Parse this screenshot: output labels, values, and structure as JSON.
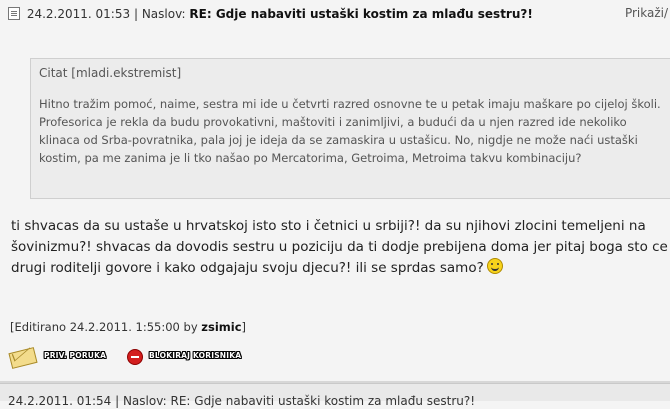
{
  "post": {
    "date": "24.2.2011. 01:53",
    "separator": "|",
    "subject_label": "Naslov:",
    "subject": "RE: Gdje nabaviti ustaški kostim za mlađu sestru?!",
    "show_label": "Prikaži/",
    "quote": {
      "author": "Citat [mladi.ekstremist]",
      "text": "Hitno tražim pomoć, naime, sestra mi ide u četvrti razred osnovne te u petak imaju maškare po cijeloj školi. Profesorica je rekla da budu provokativni, maštoviti i zanimljivi, a budući da u njen razred ide nekoliko klinaca od Srba-povratnika, pala joj je ideja da se zamaskira u ustašicu. No, nigdje ne može naći ustaški kostim, pa me zanima je li tko našao po Mercatorima, Getroima, Metroima takvu kombinaciju?"
    },
    "reply": "ti shvacas da su ustaše u hrvatskoj isto sto i četnici u srbiji?! da su njihovi zlocini temeljeni na šovinizmu?! shvacas da dovodis sestru u poziciju da ti dodje prebijena doma jer pitaj boga sto ce drugi roditelji govore i kako odgajaju svoju djecu?! ili se sprdas samo?",
    "edit": {
      "prefix": "[Editirano 24.2.2011. 1:55:00 by",
      "user": "zsimic",
      "suffix": "]"
    },
    "actions": {
      "pm_label": "PRIV. PORUKA",
      "block_label": "BLOKIRAJ KORISNIKA"
    }
  },
  "next_post": {
    "header": "24.2.2011. 01:54 | Naslov: RE: Gdje nabaviti ustaški kostim za mlađu sestru?!"
  },
  "colors": {
    "background": "#f4f4f4",
    "quote_background": "#ececec",
    "block_icon": "#d31e1e"
  }
}
